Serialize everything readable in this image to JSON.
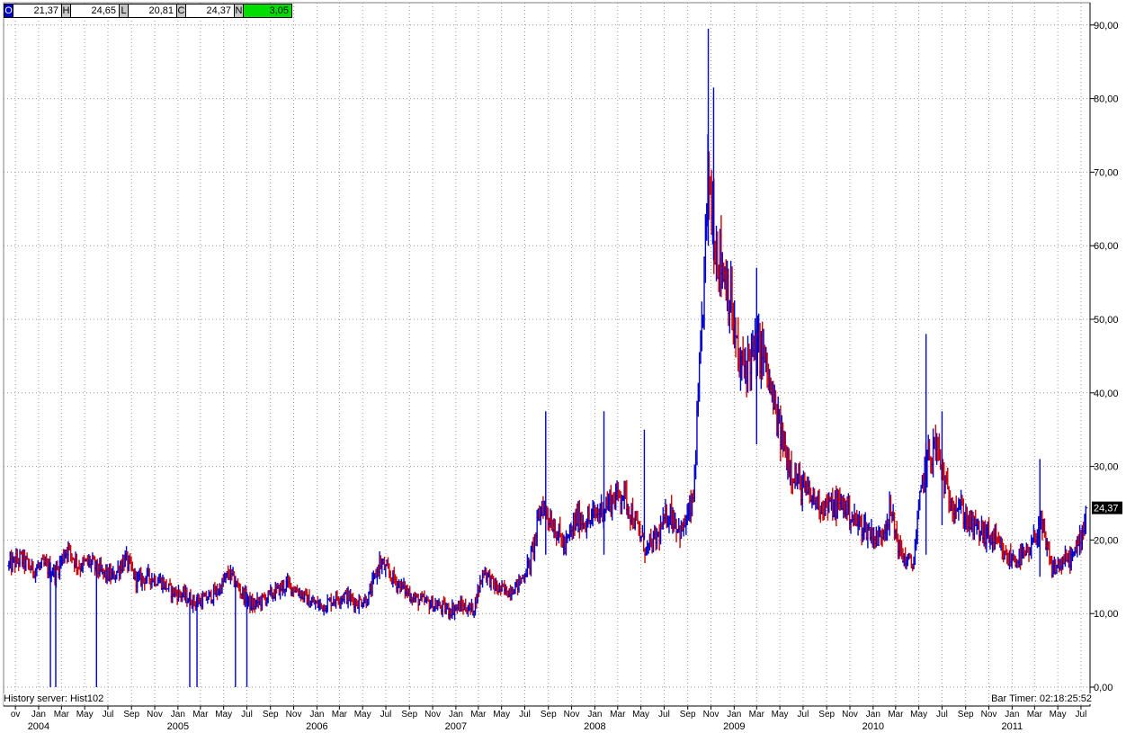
{
  "info_bar": {
    "open_tag": "O",
    "open_value": "21,37",
    "high_tag": "H",
    "high_value": "24,65",
    "low_tag": "L",
    "low_value": "20,81",
    "close_tag": "C",
    "close_value": "24,37",
    "net_tag": "N",
    "net_value": "3,05"
  },
  "footer": {
    "history_server": "History server: Hist102",
    "bar_timer": "Bar Timer: 02:18:25:52"
  },
  "colors": {
    "up": "#0000cc",
    "down": "#cc0000",
    "grid": "#999999",
    "net_badge": "#00dd00"
  },
  "chart_data": {
    "type": "ohlc_bar",
    "title": "",
    "ylim": [
      0,
      93
    ],
    "y_ticks": [
      "0,00",
      "10,00",
      "20,00",
      "30,00",
      "40,00",
      "50,00",
      "60,00",
      "70,00",
      "80,00",
      "90,00"
    ],
    "y_tick_values": [
      0,
      10,
      20,
      30,
      40,
      50,
      60,
      70,
      80,
      90
    ],
    "x_range": [
      "2003-10-01",
      "2011-07-20"
    ],
    "month_ticks": [
      {
        "label": "ov",
        "date": "2003-11-01"
      },
      {
        "label": "Jan",
        "date": "2004-01-01"
      },
      {
        "label": "Mar",
        "date": "2004-03-01"
      },
      {
        "label": "May",
        "date": "2004-05-01"
      },
      {
        "label": "Jul",
        "date": "2004-07-01"
      },
      {
        "label": "Sep",
        "date": "2004-09-01"
      },
      {
        "label": "Nov",
        "date": "2004-11-01"
      },
      {
        "label": "Jan",
        "date": "2005-01-01"
      },
      {
        "label": "Mar",
        "date": "2005-03-01"
      },
      {
        "label": "May",
        "date": "2005-05-01"
      },
      {
        "label": "Jul",
        "date": "2005-07-01"
      },
      {
        "label": "Sep",
        "date": "2005-09-01"
      },
      {
        "label": "Nov",
        "date": "2005-11-01"
      },
      {
        "label": "Jan",
        "date": "2006-01-01"
      },
      {
        "label": "Mar",
        "date": "2006-03-01"
      },
      {
        "label": "May",
        "date": "2006-05-01"
      },
      {
        "label": "Jul",
        "date": "2006-07-01"
      },
      {
        "label": "Sep",
        "date": "2006-09-01"
      },
      {
        "label": "Nov",
        "date": "2006-11-01"
      },
      {
        "label": "Jan",
        "date": "2007-01-01"
      },
      {
        "label": "Mar",
        "date": "2007-03-01"
      },
      {
        "label": "May",
        "date": "2007-05-01"
      },
      {
        "label": "Jul",
        "date": "2007-07-01"
      },
      {
        "label": "Sep",
        "date": "2007-09-01"
      },
      {
        "label": "Nov",
        "date": "2007-11-01"
      },
      {
        "label": "Jan",
        "date": "2008-01-01"
      },
      {
        "label": "Mar",
        "date": "2008-03-01"
      },
      {
        "label": "May",
        "date": "2008-05-01"
      },
      {
        "label": "Jul",
        "date": "2008-07-01"
      },
      {
        "label": "Sep",
        "date": "2008-09-01"
      },
      {
        "label": "Nov",
        "date": "2008-11-01"
      },
      {
        "label": "Jan",
        "date": "2009-01-01"
      },
      {
        "label": "Mar",
        "date": "2009-03-01"
      },
      {
        "label": "May",
        "date": "2009-05-01"
      },
      {
        "label": "Jul",
        "date": "2009-07-01"
      },
      {
        "label": "Sep",
        "date": "2009-09-01"
      },
      {
        "label": "Nov",
        "date": "2009-11-01"
      },
      {
        "label": "Jan",
        "date": "2010-01-01"
      },
      {
        "label": "Mar",
        "date": "2010-03-01"
      },
      {
        "label": "May",
        "date": "2010-05-01"
      },
      {
        "label": "Jul",
        "date": "2010-07-01"
      },
      {
        "label": "Sep",
        "date": "2010-09-01"
      },
      {
        "label": "Nov",
        "date": "2010-11-01"
      },
      {
        "label": "Jan",
        "date": "2011-01-01"
      },
      {
        "label": "Mar",
        "date": "2011-03-01"
      },
      {
        "label": "May",
        "date": "2011-05-01"
      },
      {
        "label": "Jul",
        "date": "2011-07-01"
      }
    ],
    "year_labels": [
      {
        "label": "2004",
        "date": "2004-01-01"
      },
      {
        "label": "2005",
        "date": "2005-01-01"
      },
      {
        "label": "2006",
        "date": "2006-01-01"
      },
      {
        "label": "2007",
        "date": "2007-01-01"
      },
      {
        "label": "2008",
        "date": "2008-01-01"
      },
      {
        "label": "2009",
        "date": "2009-01-01"
      },
      {
        "label": "2010",
        "date": "2010-01-01"
      },
      {
        "label": "2011",
        "date": "2011-01-01"
      }
    ],
    "last_value": 24.37,
    "last_value_label": "24,37",
    "close_path": [
      [
        "2003-10-15",
        16.5
      ],
      [
        "2003-11-15",
        17.5
      ],
      [
        "2003-12-15",
        16.0
      ],
      [
        "2004-01-15",
        16.5
      ],
      [
        "2004-02-15",
        15.5
      ],
      [
        "2004-03-15",
        19.0
      ],
      [
        "2004-04-15",
        16.5
      ],
      [
        "2004-05-15",
        17.0
      ],
      [
        "2004-06-15",
        15.5
      ],
      [
        "2004-07-15",
        15.0
      ],
      [
        "2004-08-15",
        17.5
      ],
      [
        "2004-09-15",
        14.5
      ],
      [
        "2004-10-15",
        15.0
      ],
      [
        "2004-11-15",
        14.5
      ],
      [
        "2004-12-15",
        13.0
      ],
      [
        "2005-01-15",
        12.5
      ],
      [
        "2005-02-15",
        11.5
      ],
      [
        "2005-03-15",
        12.0
      ],
      [
        "2005-04-15",
        13.0
      ],
      [
        "2005-05-15",
        15.5
      ],
      [
        "2005-06-15",
        13.0
      ],
      [
        "2005-07-15",
        11.0
      ],
      [
        "2005-08-15",
        12.0
      ],
      [
        "2005-09-15",
        13.0
      ],
      [
        "2005-10-15",
        14.0
      ],
      [
        "2005-11-15",
        13.0
      ],
      [
        "2005-12-15",
        11.5
      ],
      [
        "2006-01-15",
        11.0
      ],
      [
        "2006-02-15",
        12.0
      ],
      [
        "2006-03-15",
        12.5
      ],
      [
        "2006-04-15",
        11.5
      ],
      [
        "2006-05-15",
        12.0
      ],
      [
        "2006-06-15",
        17.0
      ],
      [
        "2006-07-15",
        15.0
      ],
      [
        "2006-08-15",
        13.5
      ],
      [
        "2006-09-15",
        12.0
      ],
      [
        "2006-10-15",
        11.5
      ],
      [
        "2006-11-15",
        11.0
      ],
      [
        "2006-12-15",
        10.5
      ],
      [
        "2007-01-15",
        11.0
      ],
      [
        "2007-02-15",
        10.5
      ],
      [
        "2007-03-15",
        16.0
      ],
      [
        "2007-04-15",
        13.5
      ],
      [
        "2007-05-15",
        13.0
      ],
      [
        "2007-06-15",
        14.0
      ],
      [
        "2007-07-15",
        17.0
      ],
      [
        "2007-08-15",
        25.0
      ],
      [
        "2007-09-15",
        22.0
      ],
      [
        "2007-10-15",
        19.0
      ],
      [
        "2007-11-15",
        23.0
      ],
      [
        "2007-12-15",
        22.5
      ],
      [
        "2008-01-15",
        24.0
      ],
      [
        "2008-02-15",
        25.5
      ],
      [
        "2008-03-15",
        26.5
      ],
      [
        "2008-04-15",
        22.5
      ],
      [
        "2008-05-15",
        18.5
      ],
      [
        "2008-06-15",
        20.5
      ],
      [
        "2008-07-15",
        24.0
      ],
      [
        "2008-08-15",
        21.0
      ],
      [
        "2008-09-15",
        25.0
      ],
      [
        "2008-10-05",
        45.0
      ],
      [
        "2008-10-25",
        70.0
      ],
      [
        "2008-11-15",
        60.0
      ],
      [
        "2008-12-15",
        55.0
      ],
      [
        "2009-01-15",
        43.0
      ],
      [
        "2009-02-15",
        45.0
      ],
      [
        "2009-03-15",
        46.0
      ],
      [
        "2009-04-15",
        38.0
      ],
      [
        "2009-05-15",
        32.0
      ],
      [
        "2009-06-15",
        28.0
      ],
      [
        "2009-07-15",
        26.0
      ],
      [
        "2009-08-15",
        25.0
      ],
      [
        "2009-09-15",
        24.5
      ],
      [
        "2009-10-15",
        25.0
      ],
      [
        "2009-11-15",
        22.5
      ],
      [
        "2009-12-15",
        21.5
      ],
      [
        "2010-01-15",
        20.0
      ],
      [
        "2010-02-15",
        24.0
      ],
      [
        "2010-03-15",
        18.0
      ],
      [
        "2010-04-15",
        16.5
      ],
      [
        "2010-05-15",
        30.0
      ],
      [
        "2010-06-15",
        33.0
      ],
      [
        "2010-07-15",
        26.0
      ],
      [
        "2010-08-15",
        24.5
      ],
      [
        "2010-09-15",
        22.0
      ],
      [
        "2010-10-15",
        21.0
      ],
      [
        "2010-11-15",
        20.0
      ],
      [
        "2010-12-15",
        17.5
      ],
      [
        "2011-01-15",
        17.5
      ],
      [
        "2011-02-15",
        18.0
      ],
      [
        "2011-03-15",
        22.5
      ],
      [
        "2011-04-15",
        16.0
      ],
      [
        "2011-05-15",
        17.0
      ],
      [
        "2011-06-15",
        18.0
      ],
      [
        "2011-07-05",
        21.5
      ],
      [
        "2011-07-15",
        24.37
      ]
    ],
    "spikes": [
      {
        "date": "2008-10-25",
        "high": 89.5,
        "low": 60
      },
      {
        "date": "2008-11-08",
        "high": 81.5,
        "low": 58
      },
      {
        "date": "2009-03-01",
        "high": 57,
        "low": 33
      },
      {
        "date": "2007-08-25",
        "high": 37.5,
        "low": 18
      },
      {
        "date": "2008-01-25",
        "high": 37.5,
        "low": 18
      },
      {
        "date": "2008-05-10",
        "high": 35,
        "low": 20
      },
      {
        "date": "2010-05-20",
        "high": 48,
        "low": 18
      },
      {
        "date": "2010-07-01",
        "high": 37.5,
        "low": 22
      },
      {
        "date": "2011-03-15",
        "high": 31,
        "low": 15
      },
      {
        "date": "2004-02-01",
        "high": 0,
        "low": 0
      },
      {
        "date": "2004-02-15",
        "high": 0,
        "low": 0
      },
      {
        "date": "2004-06-01",
        "high": 0,
        "low": 0
      },
      {
        "date": "2005-02-01",
        "high": 0,
        "low": 0
      },
      {
        "date": "2005-02-20",
        "high": 0,
        "low": 0
      },
      {
        "date": "2005-06-01",
        "high": 0,
        "low": 0
      },
      {
        "date": "2005-07-01",
        "high": 0,
        "low": 0
      }
    ],
    "grid": true
  }
}
